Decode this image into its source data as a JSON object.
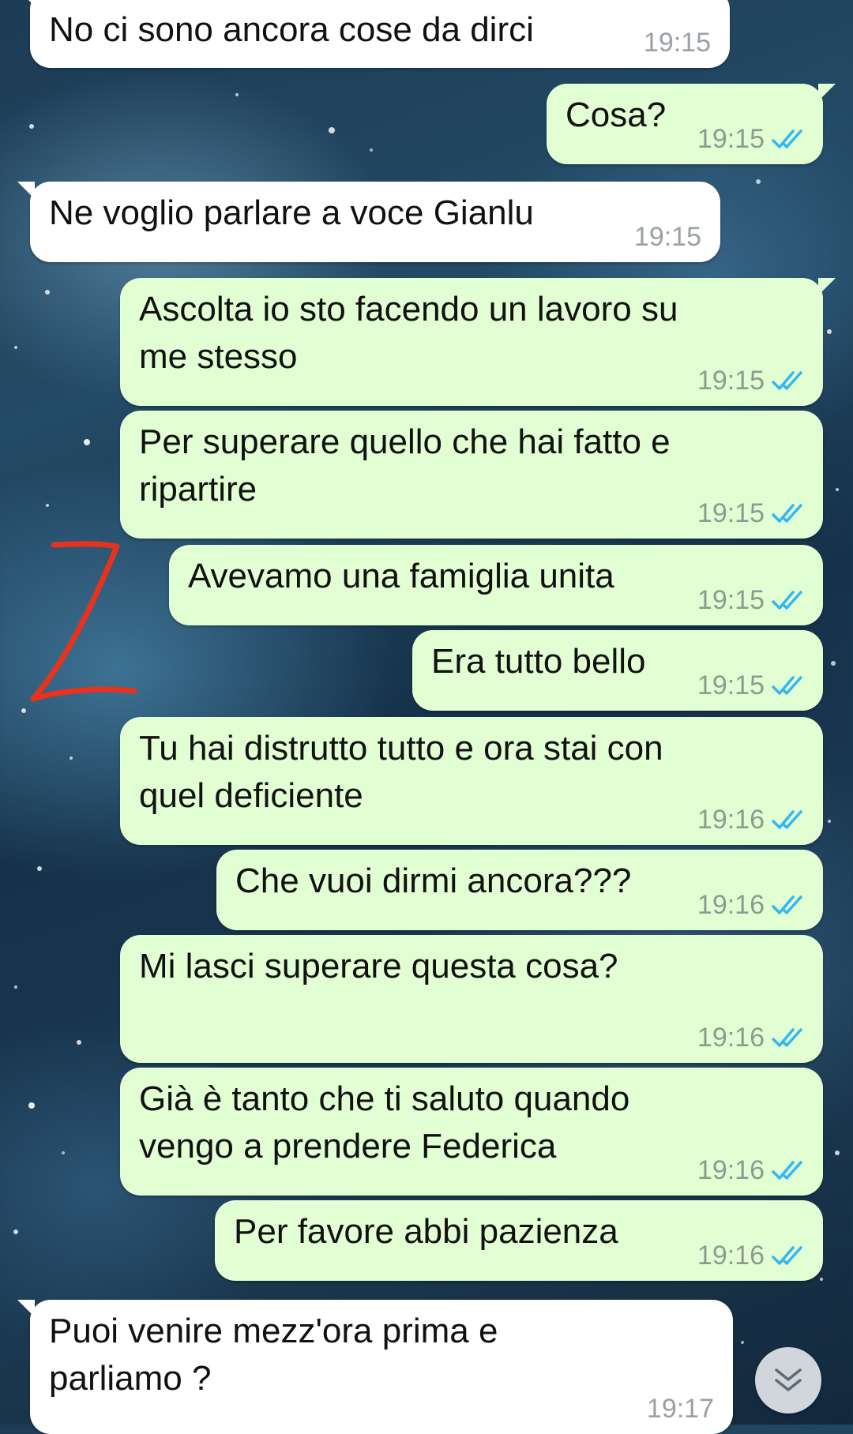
{
  "colors": {
    "incoming_bubble": "#ffffff",
    "outgoing_bubble": "#e2ffd4",
    "read_ticks": "#34b7f1",
    "annotation": "#e8321e"
  },
  "messages": [
    {
      "direction": "in",
      "text": "No ci sono ancora cose da dirci",
      "time": "19:15"
    },
    {
      "direction": "out",
      "text": "Cosa?",
      "time": "19:15",
      "status": "read"
    },
    {
      "direction": "in",
      "text": "Ne voglio parlare a voce Gianlu",
      "time": "19:15"
    },
    {
      "direction": "out",
      "text": "Ascolta io sto facendo un lavoro su\nme stesso",
      "time": "19:15",
      "status": "read"
    },
    {
      "direction": "out",
      "text": "Per superare quello che hai fatto e\nripartire",
      "time": "19:15",
      "status": "read"
    },
    {
      "direction": "out",
      "text": "Avevamo una famiglia unita",
      "time": "19:15",
      "status": "read"
    },
    {
      "direction": "out",
      "text": "Era tutto bello",
      "time": "19:15",
      "status": "read"
    },
    {
      "direction": "out",
      "text": "Tu hai distrutto tutto e ora stai con\nquel deficiente",
      "time": "19:16",
      "status": "read"
    },
    {
      "direction": "out",
      "text": "Che vuoi dirmi ancora???",
      "time": "19:16",
      "status": "read"
    },
    {
      "direction": "out",
      "text": "Mi lasci superare questa cosa?",
      "time": "19:16",
      "status": "read"
    },
    {
      "direction": "out",
      "text": "Già è tanto che ti saluto quando\nvengo a prendere Federica",
      "time": "19:16",
      "status": "read"
    },
    {
      "direction": "out",
      "text": "Per favore abbi pazienza",
      "time": "19:16",
      "status": "read"
    },
    {
      "direction": "in",
      "text": "Puoi venire mezz'ora prima e\nparliamo ?",
      "time": "19:17"
    }
  ],
  "annotation": {
    "text": "2"
  },
  "scroll_button": {
    "icon": "double-chevron-down-icon"
  }
}
